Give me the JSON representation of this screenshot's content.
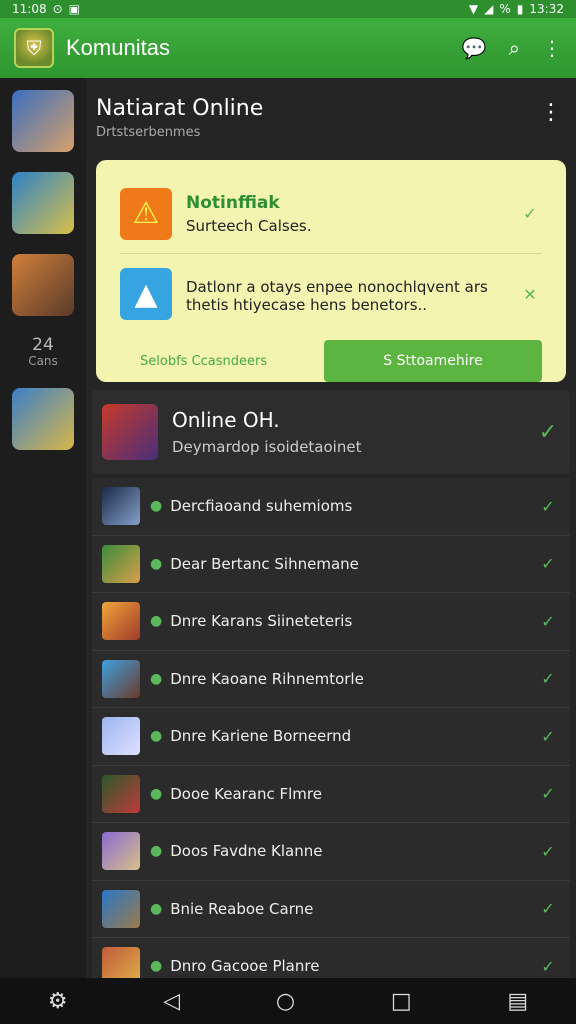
{
  "status": {
    "time": "11:08",
    "clock_right": "13:32",
    "battery": "%"
  },
  "app": {
    "title": "Komunitas",
    "icons": [
      "chat-icon",
      "search-icon",
      "more-vert-icon"
    ]
  },
  "side": {
    "count_value": "24",
    "count_label": "Cans"
  },
  "header": {
    "title": "Natiarat Online",
    "subtitle": "Drtstserbenmes"
  },
  "notifications": {
    "items": [
      {
        "title": "Notinffiak",
        "body": "Surteech Calses.",
        "icon": "warning-icon",
        "mark": "✓"
      },
      {
        "title": "",
        "body": "Datlonr a otays enpee nonochlqvent ars thetis htiyecase hens benetors..",
        "icon": "triangle-icon",
        "mark": "✕"
      }
    ],
    "secondary_label": "Selobfs Ccasndeers",
    "primary_label": "S Sttoamehire"
  },
  "online": {
    "title": "Online OH.",
    "subtitle": "Deymardop isoidetaoinet"
  },
  "list": [
    {
      "label": "Dercfiaoand suhemioms"
    },
    {
      "label": "Dear Bertanc Sihnemane"
    },
    {
      "label": "Dnre Karans Siineteteris"
    },
    {
      "label": "Dnre Kaoane Rihnemtorle"
    },
    {
      "label": "Dnre Kariene Borneernd"
    },
    {
      "label": "Dooe Kearanc Flmre"
    },
    {
      "label": "Doos Favdne Klanne"
    },
    {
      "label": "Bnie Reaboe Carne"
    },
    {
      "label": "Dnro Gacooe Planre"
    }
  ],
  "nav": [
    "settings-icon",
    "back-icon",
    "home-icon",
    "recents-icon",
    "feedback-icon"
  ]
}
